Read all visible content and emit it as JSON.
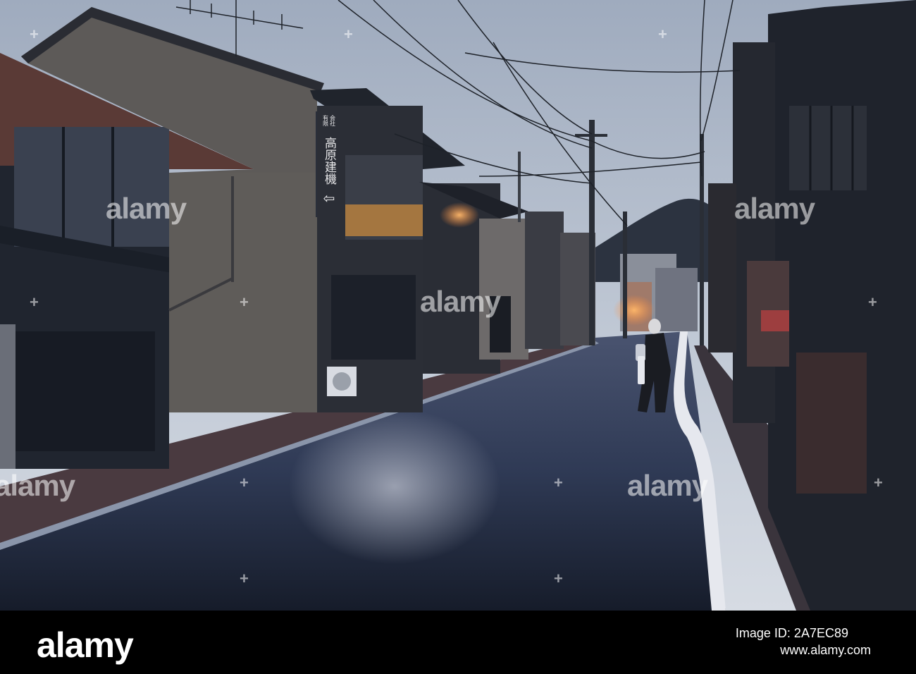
{
  "image": {
    "description_colors": {
      "sky": "#b8c2d0",
      "road": "#2a3346",
      "building_dark": "#1c2230",
      "building_wall": "#5a5a5e",
      "lamp_glow": "#e8a64a"
    }
  },
  "sign": {
    "small_top": "有限",
    "small_bottom": "会社",
    "main": "高原建機",
    "arrow": "⇦"
  },
  "watermark": {
    "text": "alamy"
  },
  "footer": {
    "logo": "alamy",
    "image_id_label": "Image ID: 2A7EC89",
    "url": "www.alamy.com"
  }
}
